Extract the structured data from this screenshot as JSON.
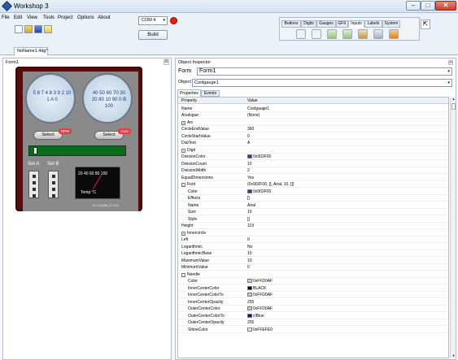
{
  "window": {
    "title": "Workshop 3",
    "min": "–",
    "max": "□",
    "close": "✕"
  },
  "menu": [
    {
      "label": "File",
      "id": "file"
    },
    {
      "label": "Edit",
      "id": "edit"
    },
    {
      "label": "View",
      "id": "view"
    },
    {
      "label": "Tools",
      "id": "tools"
    },
    {
      "label": "Project",
      "id": "project"
    },
    {
      "label": "Options",
      "id": "options"
    },
    {
      "label": "About",
      "id": "about"
    }
  ],
  "com": {
    "port": "COM 4",
    "arrow": "▾",
    "build_label": "Build"
  },
  "palette": {
    "tabs": [
      "Buttons",
      "Digits",
      "Gauges",
      "GFX",
      "Inputs",
      "Labels",
      "System"
    ],
    "active_tab": "Inputs",
    "icons": [
      "knob-icon",
      "dial-icon",
      "slider-icon",
      "trackbar-icon",
      "switch-icon",
      "rocker-icon",
      "keyboard-icon"
    ]
  },
  "document": {
    "tab": "NoName1.4dg*"
  },
  "form_panel": {
    "title": "Form1",
    "close": "⊟",
    "gauge_left_labels": "5 6 7 4 8 3 9 2 10 1 A 0",
    "gauge_right_labels": "40 50 60 70 30 20 80 10 90 0 B 100",
    "select1": "Select",
    "select2": "Select",
    "badge1": "RPM",
    "badge2": "Cool",
    "setA": "Set A",
    "setB": "Set B",
    "meter_scale": "20 40 60 80 100",
    "meter_label": "Temp °C",
    "watermark": "0.0.V4496_C 9.01"
  },
  "inspector": {
    "title": "Object Inspector",
    "close": "⊟",
    "form_label": "Form",
    "form_value": "Form1",
    "object_label": "Object",
    "object_value": "Coolgauge1",
    "tab_properties": "Properties",
    "tab_events": "Events",
    "col_property": "Property",
    "col_value": "Value",
    "dropdown_arrow": "▾",
    "scroll_up": "▴",
    "scroll_down": "▾",
    "rows": [
      {
        "name": "Name",
        "value": "Coolgauge1"
      },
      {
        "name": "Analogue",
        "value": "(None)"
      },
      {
        "name": "Arc",
        "value": "",
        "expander": "+"
      },
      {
        "name": "CircleEndValue",
        "value": "360"
      },
      {
        "name": "CircleStartValue",
        "value": "0"
      },
      {
        "name": "DialText",
        "value": "A"
      },
      {
        "name": "Digit",
        "value": "",
        "expander": "+"
      },
      {
        "name": "DivisionColor",
        "value": "0x902F00",
        "swatch": "#1f3f8f"
      },
      {
        "name": "DivisionCount",
        "value": "10"
      },
      {
        "name": "DivisionWidth",
        "value": "2"
      },
      {
        "name": "EqualDimensions",
        "value": "Yes"
      },
      {
        "name": "Font",
        "value": "(0x902F00, [], Arial, 10, [])",
        "expander": "–"
      },
      {
        "name": "Color",
        "value": "0x902F00",
        "swatch": "#1f3f8f",
        "sub": true
      },
      {
        "name": "Effects",
        "value": "[]",
        "sub": true
      },
      {
        "name": "Name",
        "value": "Arial",
        "sub": true
      },
      {
        "name": "Size",
        "value": "10",
        "sub": true
      },
      {
        "name": "Style",
        "value": "[]",
        "sub": true
      },
      {
        "name": "Height",
        "value": "119"
      },
      {
        "name": "Innercircle",
        "value": "",
        "expander": "+"
      },
      {
        "name": "Left",
        "value": "0"
      },
      {
        "name": "Logarithmic",
        "value": "No"
      },
      {
        "name": "LogarithmicBase",
        "value": "10"
      },
      {
        "name": "MaximumValue",
        "value": "10"
      },
      {
        "name": "MinimumValue",
        "value": "0"
      },
      {
        "name": "Needle",
        "value": "",
        "expander": "–"
      },
      {
        "name": "Color",
        "value": "0xFFD0AF",
        "swatch": "#b8d0f0",
        "sub": true
      },
      {
        "name": "InnerCenterColor",
        "value": "BLACK",
        "swatch": "#000000",
        "sub": true
      },
      {
        "name": "InnerCenterColorTo",
        "value": "0xFFD0AF",
        "swatch": "#b8d0f0",
        "sub": true
      },
      {
        "name": "InnerCenterOpacity",
        "value": "255",
        "sub": true
      },
      {
        "name": "OuterCenterColor",
        "value": "0xFFD0AF",
        "swatch": "#b8d0f0",
        "sub": true
      },
      {
        "name": "OuterCenterColorTo",
        "value": "clBlue",
        "swatch": "#0000ff",
        "sub": true
      },
      {
        "name": "OuterCenterOpacity",
        "value": "255",
        "sub": true
      },
      {
        "name": "ShineColor",
        "value": "0xFFEFE0",
        "swatch": "#e0efff",
        "sub": true
      }
    ]
  }
}
